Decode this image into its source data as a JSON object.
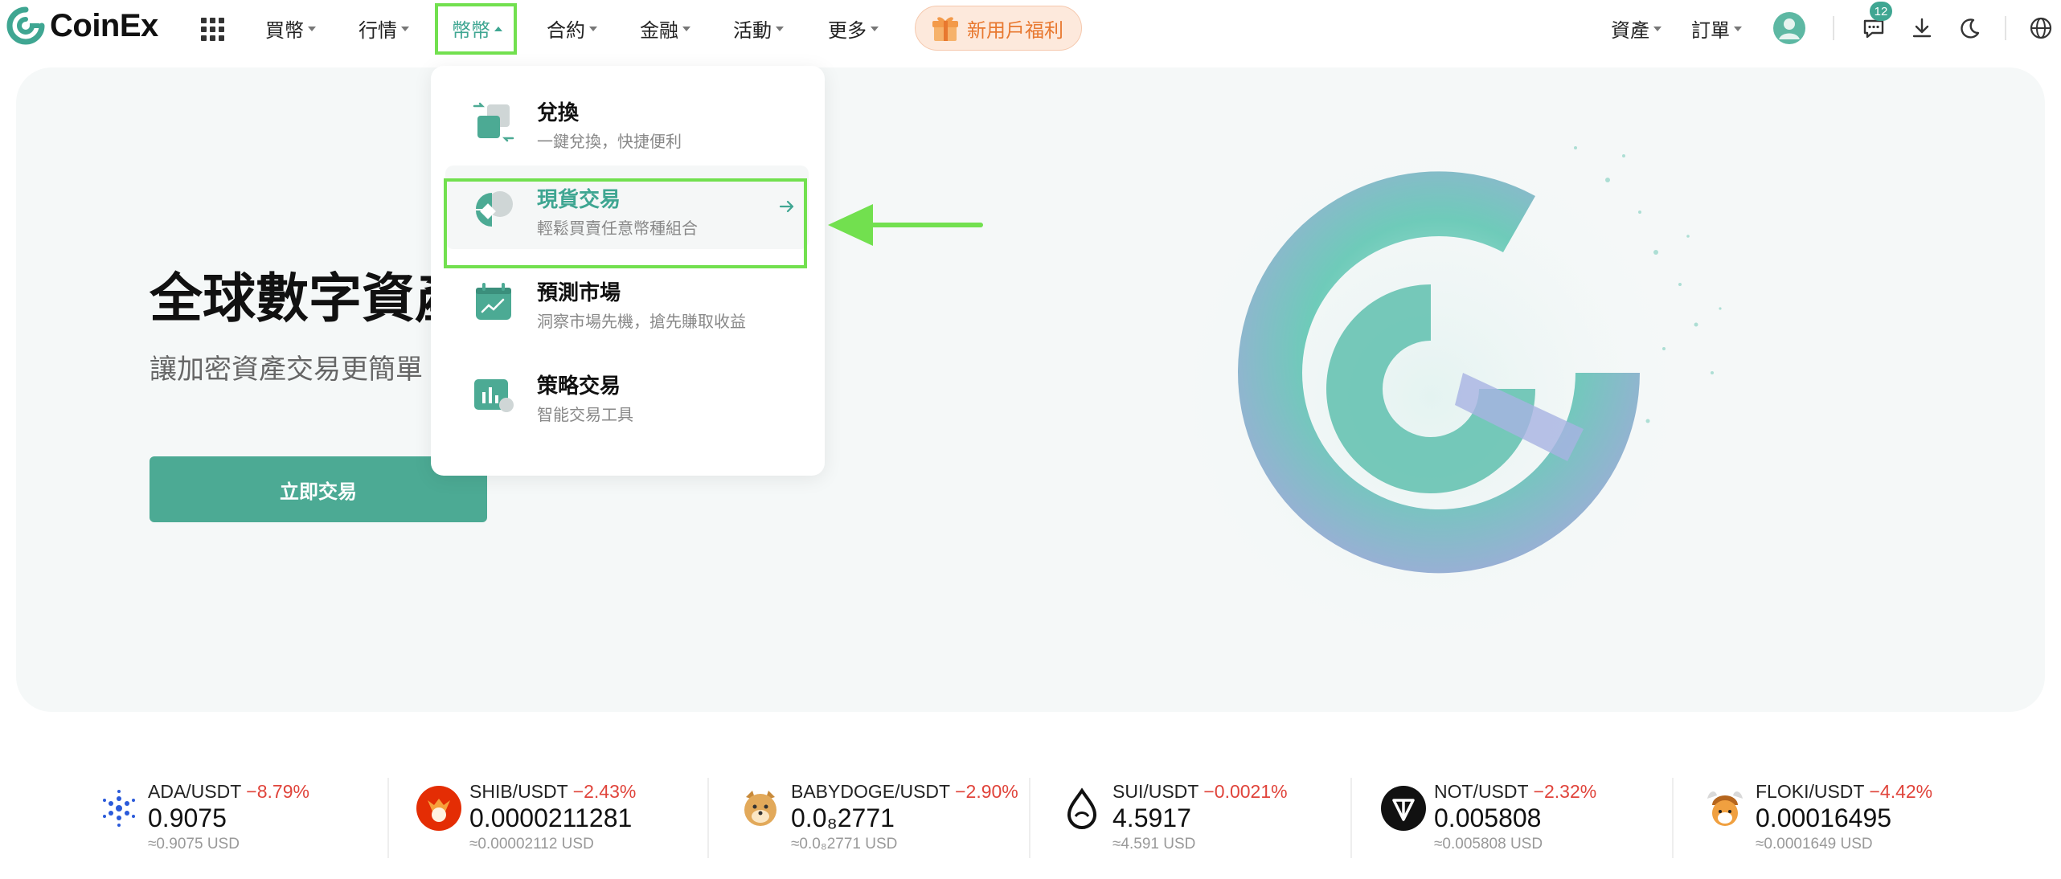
{
  "brand": {
    "name": "CoinEx",
    "accent": "#3fa692",
    "highlight": "#72e04f"
  },
  "nav": {
    "items": [
      {
        "label": "買幣"
      },
      {
        "label": "行情"
      },
      {
        "label": "幣幣"
      },
      {
        "label": "合約"
      },
      {
        "label": "金融"
      },
      {
        "label": "活動"
      },
      {
        "label": "更多"
      }
    ],
    "promo": "新用戶福利",
    "right": {
      "assets": "資產",
      "orders": "訂單",
      "message_count": "12"
    }
  },
  "dropdown": {
    "items": [
      {
        "title": "兌換",
        "desc": "一鍵兌換，快捷便利",
        "icon": "swap-icon"
      },
      {
        "title": "現貨交易",
        "desc": "輕鬆買賣任意幣種組合",
        "icon": "spot-trading-icon"
      },
      {
        "title": "預測市場",
        "desc": "洞察市場先機，搶先賺取收益",
        "icon": "prediction-market-icon"
      },
      {
        "title": "策略交易",
        "desc": "智能交易工具",
        "icon": "strategy-trading-icon"
      }
    ]
  },
  "hero": {
    "title": "全球數字資產",
    "subtitle": "讓加密資產交易更簡單",
    "cta": "立即交易"
  },
  "tickers": [
    {
      "pair": "ADA/USDT",
      "change": "−8.79%",
      "price": "0.9075",
      "usd": "≈0.9075 USD",
      "icon": "ada-icon"
    },
    {
      "pair": "SHIB/USDT",
      "change": "−2.43%",
      "price": "0.0000211281",
      "usd": "≈0.00002112 USD",
      "icon": "shib-icon"
    },
    {
      "pair": "BABYDOGE/USDT",
      "change": "−2.90%",
      "price": "0.0₈2771",
      "usd": "≈0.0₈2771 USD",
      "icon": "babydoge-icon"
    },
    {
      "pair": "SUI/USDT",
      "change": "−0.0021%",
      "price": "4.5917",
      "usd": "≈4.591 USD",
      "icon": "sui-icon"
    },
    {
      "pair": "NOT/USDT",
      "change": "−2.32%",
      "price": "0.005808",
      "usd": "≈0.005808 USD",
      "icon": "not-icon"
    },
    {
      "pair": "FLOKI/USDT",
      "change": "−4.42%",
      "price": "0.00016495",
      "usd": "≈0.0001649 USD",
      "icon": "floki-icon"
    }
  ]
}
